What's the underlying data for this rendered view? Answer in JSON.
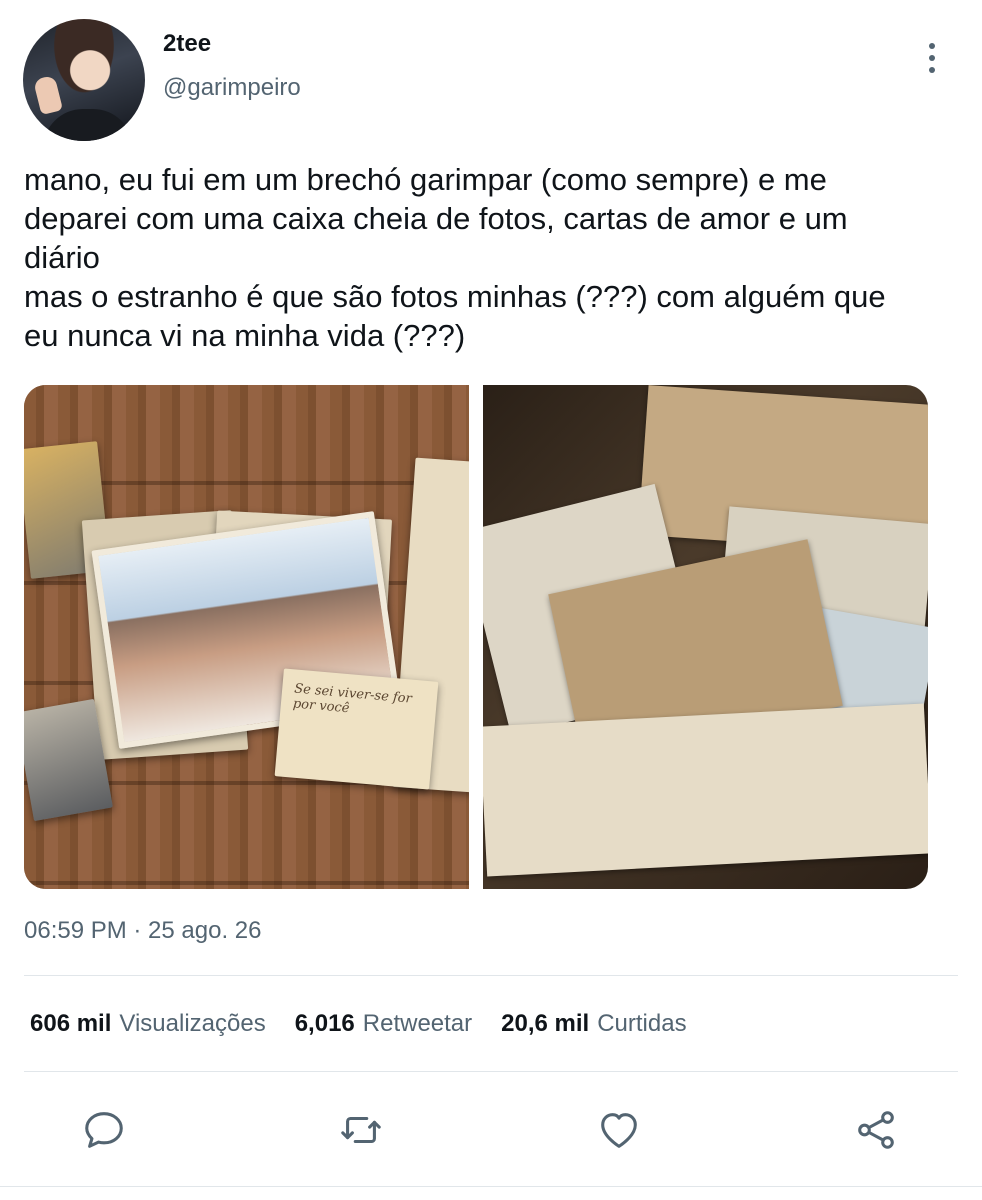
{
  "author": {
    "display_name": "2tee",
    "handle": "@garimpeiro"
  },
  "tweet": {
    "lines": [
      "mano, eu fui em um brechó garimpar (como sempre) e me",
      "deparei com uma caixa cheia de fotos, cartas de amor e um",
      "diário",
      "mas o estranho é que são fotos minhas (???) com alguém que",
      "eu nunca vi na minha vida (???)"
    ],
    "note_text": "Se sei viver-se for por você",
    "timestamp": "06:59 PM · 25 ago. 26"
  },
  "stats": {
    "views_count": "606 mil",
    "views_label": "Visualizações",
    "retweets_count": "6,016",
    "retweets_label": "Retweetar",
    "likes_count": "20,6 mil",
    "likes_label": "Curtidas"
  },
  "icons": {
    "more": "more-vertical-icon",
    "reply": "reply-icon",
    "retweet": "retweet-icon",
    "like": "heart-icon",
    "share": "share-icon"
  },
  "colors": {
    "text_primary": "#0f1419",
    "text_secondary": "#536471",
    "divider": "#e1e6ea"
  }
}
